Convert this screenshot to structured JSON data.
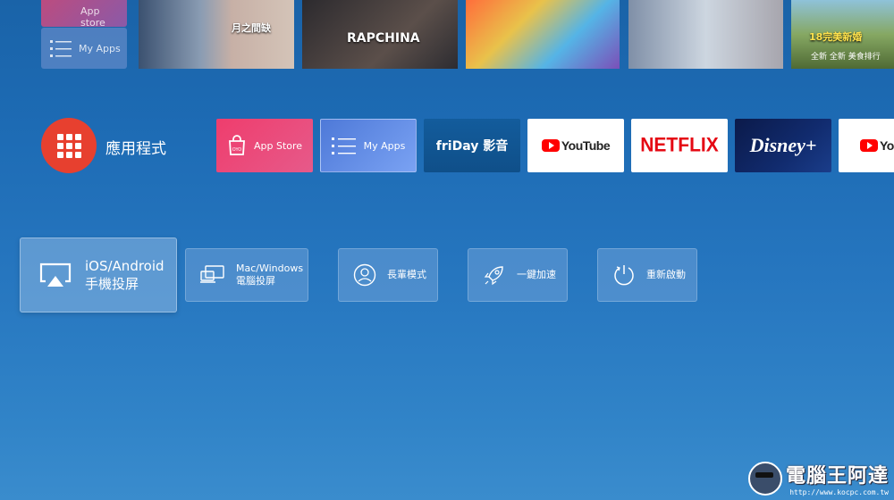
{
  "top_row": {
    "mini_tiles": [
      {
        "label": "App store"
      },
      {
        "label": "My Apps"
      }
    ],
    "thumbnails": [
      {
        "caption": "月之間缺"
      },
      {
        "caption": "RAPCHINA"
      },
      {
        "caption": ""
      },
      {
        "caption": ""
      },
      {
        "caption": "18完美新婚",
        "subcaption": "全新 全新 美食排行"
      }
    ]
  },
  "apps_row": {
    "section_label": "應用程式",
    "tiles": [
      {
        "label": "App Store"
      },
      {
        "label": "My Apps"
      },
      {
        "logo_text": "friDay 影音"
      },
      {
        "logo_text": "YouTube"
      },
      {
        "logo_text": "NETFLIX"
      },
      {
        "logo_text": "Disney+"
      },
      {
        "logo_text": "You"
      }
    ]
  },
  "cast_row": [
    {
      "line1": "iOS/Android",
      "line2": "手機投屏"
    },
    {
      "line1": "Mac/Windows",
      "line2": "電腦投屏"
    },
    {
      "line1": "長輩模式"
    },
    {
      "line1": "一鍵加速"
    },
    {
      "line1": "重新啟動"
    }
  ],
  "watermark": {
    "title": "電腦王阿達",
    "url": "http://www.kocpc.com.tw"
  },
  "colors": {
    "apps_icon": "#e7402f",
    "app_store": "#ef3d6d",
    "my_apps": "#5b86e0",
    "netflix": "#e50914",
    "youtube": "#ff0000"
  }
}
